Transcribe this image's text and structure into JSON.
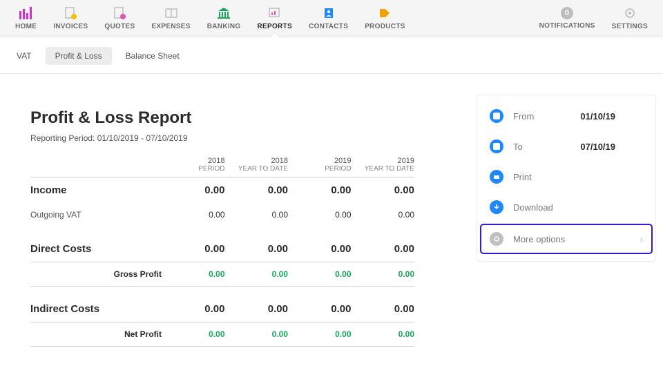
{
  "nav": {
    "items": [
      {
        "label": "HOME",
        "name": "nav-home"
      },
      {
        "label": "INVOICES",
        "name": "nav-invoices"
      },
      {
        "label": "QUOTES",
        "name": "nav-quotes"
      },
      {
        "label": "EXPENSES",
        "name": "nav-expenses"
      },
      {
        "label": "BANKING",
        "name": "nav-banking"
      },
      {
        "label": "REPORTS",
        "name": "nav-reports",
        "active": true
      },
      {
        "label": "CONTACTS",
        "name": "nav-contacts"
      },
      {
        "label": "PRODUCTS",
        "name": "nav-products"
      }
    ],
    "notifications": {
      "label": "NOTIFICATIONS",
      "count": 0
    },
    "settings_label": "SETTINGS"
  },
  "subtabs": {
    "items": [
      "VAT",
      "Profit & Loss",
      "Balance Sheet"
    ],
    "active": 1
  },
  "report": {
    "title": "Profit & Loss Report",
    "subtitle": "Reporting Period: 01/10/2019 - 07/10/2019",
    "columns": [
      {
        "year": "2018",
        "period": "PERIOD"
      },
      {
        "year": "2018",
        "period": "YEAR TO DATE"
      },
      {
        "year": "2019",
        "period": "PERIOD"
      },
      {
        "year": "2019",
        "period": "YEAR TO DATE"
      }
    ],
    "sections": [
      {
        "heading": "Income",
        "head_values": [
          "0.00",
          "0.00",
          "0.00",
          "0.00"
        ],
        "rows": [
          {
            "label": "Outgoing VAT",
            "values": [
              "0.00",
              "0.00",
              "0.00",
              "0.00"
            ]
          }
        ]
      },
      {
        "heading": "Direct Costs",
        "head_values": [
          "0.00",
          "0.00",
          "0.00",
          "0.00"
        ],
        "rows": [],
        "summary": {
          "label": "Gross Profit",
          "values": [
            "0.00",
            "0.00",
            "0.00",
            "0.00"
          ]
        }
      },
      {
        "heading": "Indirect Costs",
        "head_values": [
          "0.00",
          "0.00",
          "0.00",
          "0.00"
        ],
        "rows": [],
        "summary": {
          "label": "Net Profit",
          "values": [
            "0.00",
            "0.00",
            "0.00",
            "0.00"
          ]
        }
      }
    ]
  },
  "side": {
    "from_label": "From",
    "from_value": "01/10/19",
    "to_label": "To",
    "to_value": "07/10/19",
    "print": "Print",
    "download": "Download",
    "more": "More options"
  }
}
